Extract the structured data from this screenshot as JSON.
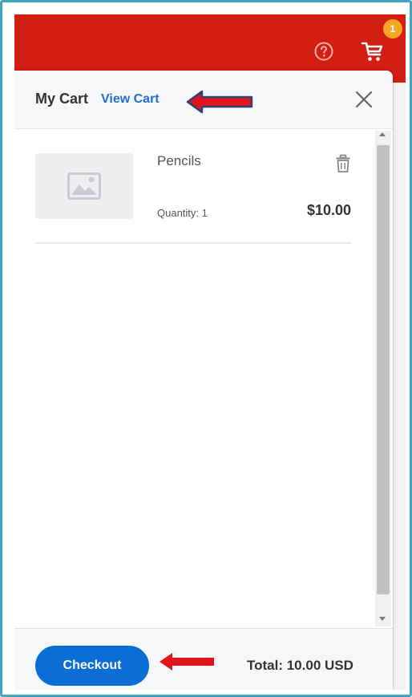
{
  "header": {
    "cart_badge_count": "1",
    "bar_color": "#d31f12",
    "icons": [
      "help-icon",
      "cart-icon"
    ]
  },
  "cart_panel": {
    "title": "My Cart",
    "view_cart_label": "View Cart",
    "close_icon": "close-icon",
    "items": [
      {
        "name": "Pencils",
        "quantity_label": "Quantity: 1",
        "price": "$10.00",
        "image_icon": "image-placeholder-icon",
        "delete_icon": "trash-icon"
      }
    ]
  },
  "footer": {
    "checkout_label": "Checkout",
    "total_label": "Total: 10.00 USD"
  },
  "colors": {
    "accent": "#0b6ed6",
    "link": "#1f6fd1",
    "badge": "#f5a623",
    "annotation_arrow": "#e0141b"
  }
}
